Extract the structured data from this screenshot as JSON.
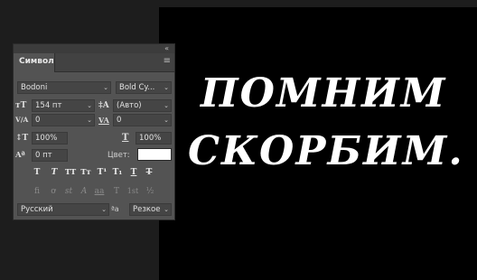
{
  "canvas": {
    "line1": "ПОМНИМ",
    "line2": "СКОРБИМ."
  },
  "panel": {
    "collapse_glyph": "«",
    "tab": "Символ",
    "menu_glyph": "≡",
    "font_family": "Bodoni",
    "font_style": "Bold Cy...",
    "font_size": "154 пт",
    "leading": "(Авто)",
    "kerning": "0",
    "tracking": "0",
    "vscale": "100%",
    "hscale": "100%",
    "baseline": "0 пт",
    "color_label": "Цвет:",
    "language": "Русский",
    "antialias": "Резкое",
    "aa_icon": "ªa",
    "dropdown_arrow": "⌄",
    "style_buttons": [
      "T",
      "T",
      "TT",
      "Tт",
      "T¹",
      "T₁",
      "T",
      "T"
    ],
    "opentype_buttons": [
      "fi",
      "ơ",
      "st",
      "A",
      "aa",
      "T",
      "1st",
      "½"
    ],
    "icons": {
      "size": "ᴛT",
      "leading": "‡A",
      "kerning": "V/A",
      "tracking": "VA",
      "vscale": "↕T",
      "hscale": "T",
      "baseline": "Aª"
    }
  }
}
